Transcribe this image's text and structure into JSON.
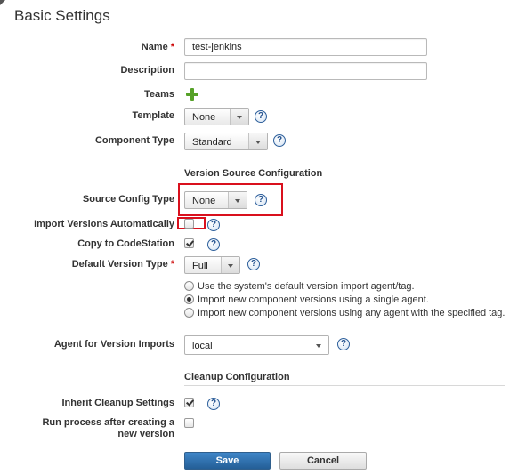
{
  "page": {
    "title": "Basic Settings"
  },
  "labels": {
    "name": "Name",
    "description": "Description",
    "teams": "Teams",
    "template": "Template",
    "component_type": "Component Type",
    "source_config_type": "Source Config Type",
    "import_versions_automatically": "Import Versions Automatically",
    "copy_to_codestation": "Copy to CodeStation",
    "default_version_type": "Default Version Type",
    "agent_for_version_imports": "Agent for Version Imports",
    "inherit_cleanup_settings": "Inherit Cleanup Settings",
    "run_process_after_creating_line1": "Run process after creating a",
    "run_process_after_creating_line2": "new version"
  },
  "required_marker": "*",
  "help_glyph": "?",
  "fields": {
    "name": "test-jenkins",
    "description": "",
    "template": "None",
    "component_type": "Standard",
    "source_config_type": "None",
    "default_version_type": "Full",
    "agent": "local"
  },
  "checkboxes": {
    "import_versions_automatically": false,
    "copy_to_codestation": true,
    "inherit_cleanup_settings": true,
    "run_process_after_creating": false
  },
  "sections": {
    "version_source": "Version Source Configuration",
    "cleanup": "Cleanup Configuration"
  },
  "radio_options": [
    {
      "label": "Use the system's default version import agent/tag.",
      "selected": false
    },
    {
      "label": "Import new component versions using a single agent.",
      "selected": true
    },
    {
      "label": "Import new component versions using any agent with the specified tag.",
      "selected": false
    }
  ],
  "buttons": {
    "save": "Save",
    "cancel": "Cancel"
  },
  "icons": {
    "teams_add": "plus-icon",
    "help": "help-icon",
    "dropdown": "chevron-down-icon"
  },
  "colors": {
    "required": "#cc0000",
    "highlight": "#d9101d",
    "save_button": "#2f6ea9",
    "add_icon": "#56a128"
  }
}
